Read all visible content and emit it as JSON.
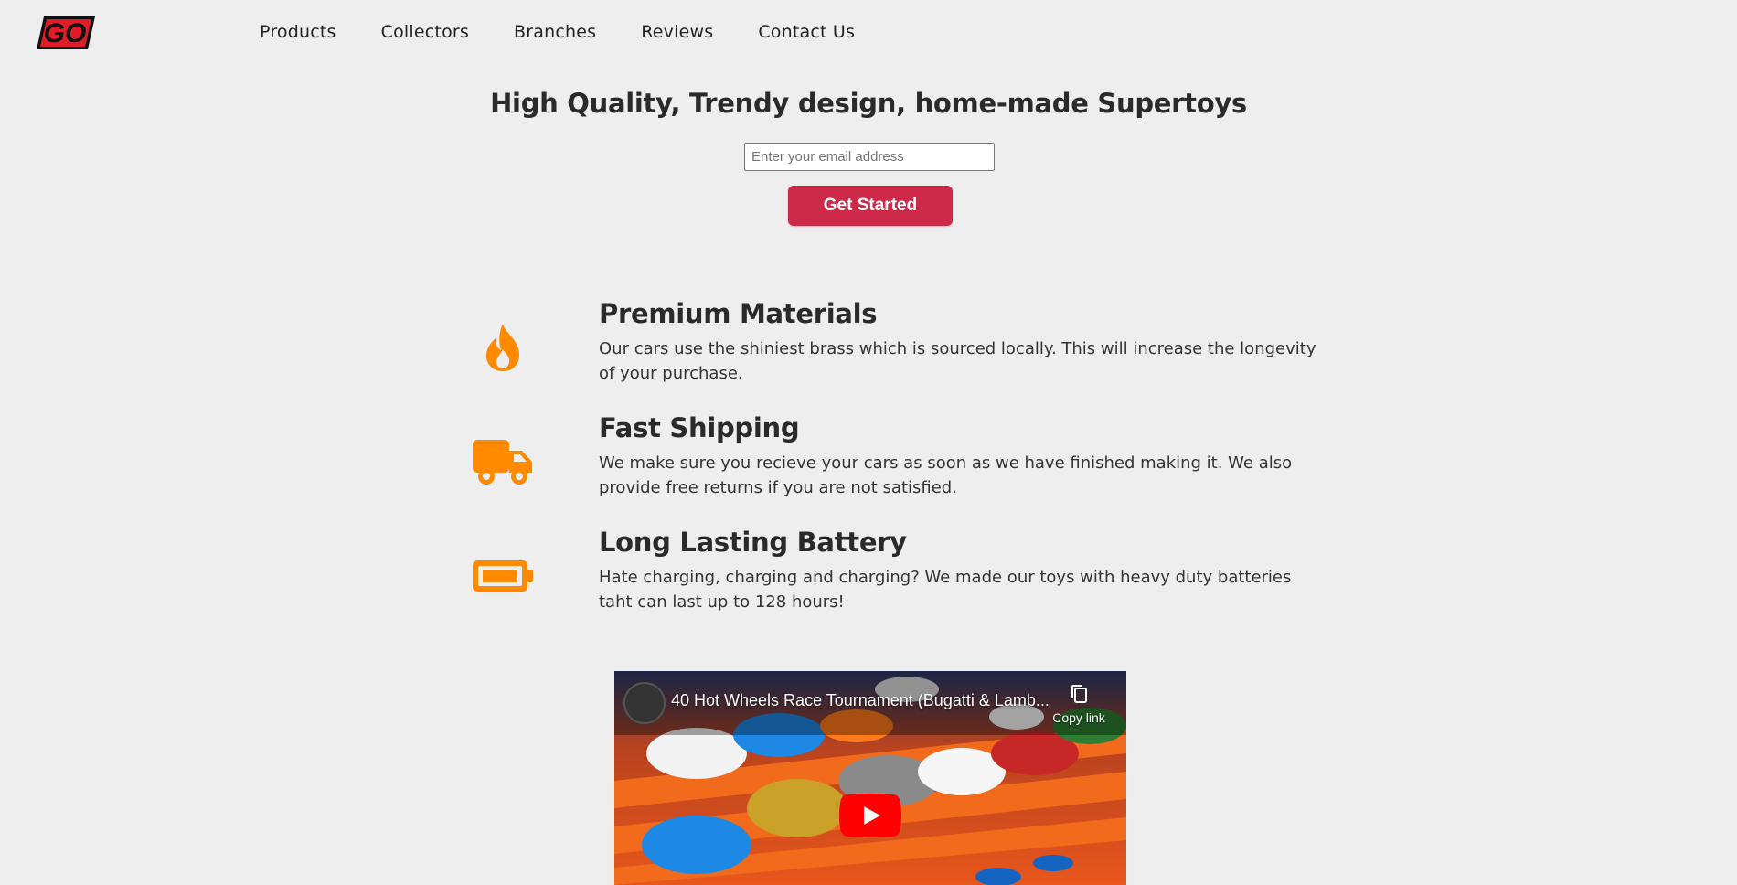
{
  "brand": {
    "logo_text": "GO",
    "logo_color": "#e01c2a"
  },
  "nav": {
    "items": [
      {
        "label": "Products"
      },
      {
        "label": "Collectors"
      },
      {
        "label": "Branches"
      },
      {
        "label": "Reviews"
      },
      {
        "label": "Contact Us"
      }
    ]
  },
  "hero": {
    "title": "High Quality, Trendy design, home-made Supertoys",
    "email_placeholder": "Enter your email address",
    "email_value": "",
    "cta_label": "Get Started",
    "cta_color": "#cc2a48"
  },
  "features": [
    {
      "icon": "fire-icon",
      "title": "Premium Materials",
      "text": "Our cars use the shiniest brass which is sourced locally. This will increase the longevity of your purchase."
    },
    {
      "icon": "truck-icon",
      "title": "Fast Shipping",
      "text": "We make sure you recieve your cars as soon as we have finished making it. We also provide free returns if you are not satisfied."
    },
    {
      "icon": "battery-icon",
      "title": "Long Lasting Battery",
      "text": "Hate charging, charging and charging? We made our toys with heavy duty batteries taht can last up to 128 hours!"
    }
  ],
  "accent_color": "#ff8a00",
  "video": {
    "title": "40 Hot Wheels Race Tournament (Bugatti & Lamb...",
    "copy_link_label": "Copy link"
  }
}
